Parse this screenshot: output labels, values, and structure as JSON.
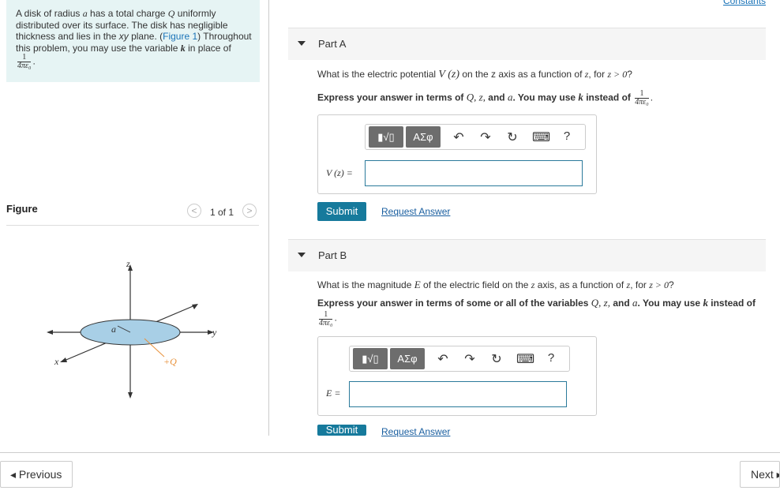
{
  "intro": {
    "text_1": "A disk of radius ",
    "var_a": "a",
    "text_2": " has a total charge ",
    "var_Q": "Q",
    "text_3": " uniformly distributed over its surface. The disk has negligible thickness and lies in the ",
    "plane_xy": "xy",
    "text_4": " plane. (",
    "figure_link": "Figure 1",
    "text_5": ") Throughout this problem, you may use the variable ",
    "var_k": "k",
    "text_6": " in place of",
    "frac_num": "1",
    "frac_den": "4πε₀",
    "frac_end": "."
  },
  "figure": {
    "title": "Figure",
    "prev_icon": "chevron-left-icon",
    "next_icon": "chevron-right-icon",
    "prev_glyph": "<",
    "next_glyph": ">",
    "counter": "1 of 1",
    "labels": {
      "z": "z",
      "y": "y",
      "x": "x",
      "a": "a",
      "q": "+Q"
    },
    "disk_color": "#a8cfe6",
    "charge_color": "#e8913a"
  },
  "constants_link": "Constants",
  "partA": {
    "label": "Part A",
    "question_1": "What is the electric potential ",
    "question_var": "V (z)",
    "question_2": " on the z axis as a function of ",
    "question_z": "z",
    "question_3": ", for ",
    "question_cond": "z > 0",
    "question_4": "?",
    "express_1": "Express your answer in terms of ",
    "express_vars": "Q, z,",
    "express_and": " and ",
    "express_a": "a",
    "express_2": ". You may use ",
    "express_k": "k",
    "express_3": " instead of",
    "answer_label": "V (z) =",
    "submit": "Submit",
    "request": "Request Answer"
  },
  "partB": {
    "label": "Part B",
    "question_1": "What is the magnitude ",
    "question_var": "E",
    "question_2": " of the electric field on the ",
    "question_z": "z",
    "question_3": " axis, as a function of ",
    "question_z2": "z",
    "question_4": ", for ",
    "question_cond": "z > 0",
    "question_5": "?",
    "express_1": "Express your answer in terms of some or all of the variables ",
    "express_vars": "Q, z,",
    "express_and": " and ",
    "express_a": "a",
    "express_2": ". You may use ",
    "express_k": "k",
    "express_3": " instead of",
    "answer_label": "E =",
    "submit": "Submit",
    "request": "Request Answer"
  },
  "toolbar": {
    "templates_label": "▮√▯",
    "symbols_label": "ΑΣφ",
    "undo": "↶",
    "redo": "↷",
    "reset": "↻",
    "keyboard": "⌨",
    "help": "?"
  },
  "footer": {
    "previous": "◂ Previous",
    "next": "Next ▸"
  }
}
